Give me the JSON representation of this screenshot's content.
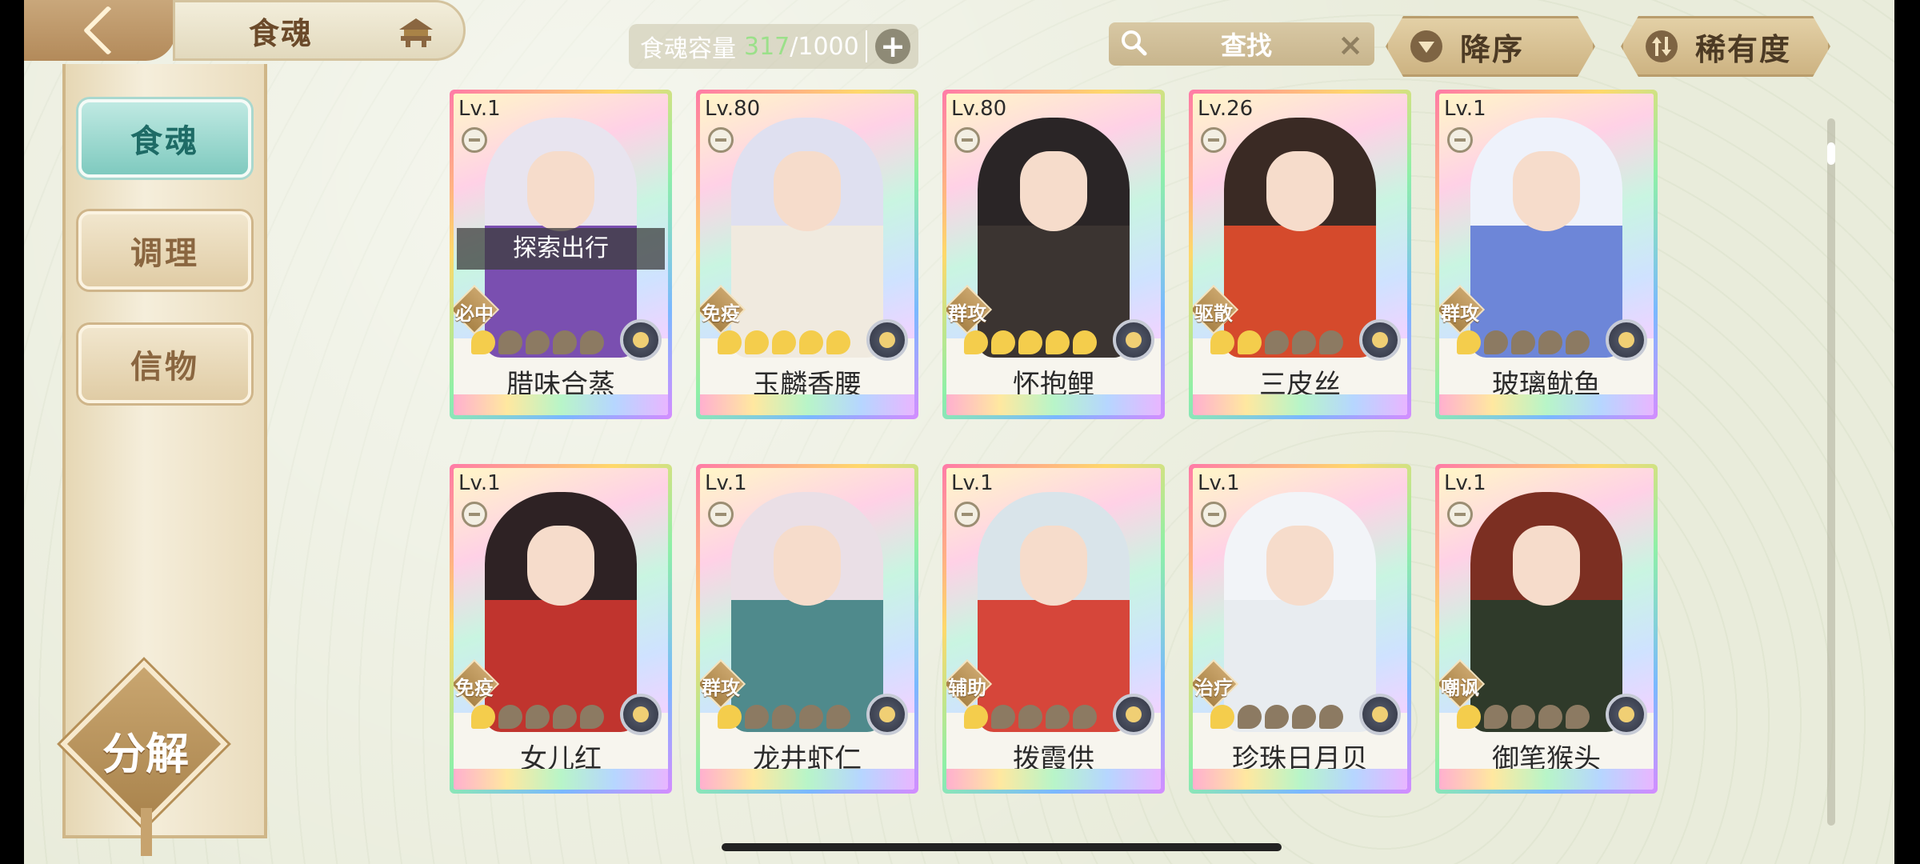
{
  "header": {
    "title": "食魂",
    "capacity": {
      "label": "食魂容量",
      "current": "317",
      "separator": "/",
      "max": "1000",
      "add": "+"
    },
    "search": {
      "text": "查找",
      "clear": "×"
    },
    "sort_order": "降序",
    "sort_field": "稀有度"
  },
  "sidebar": {
    "items": [
      {
        "label": "食魂",
        "active": true
      },
      {
        "label": "调理",
        "active": false
      },
      {
        "label": "信物",
        "active": false
      }
    ],
    "decompose": "分解"
  },
  "cards": [
    {
      "level": "Lv.1",
      "role": "必中",
      "stars": 1,
      "name": "腊味合蒸",
      "status": "探索出行",
      "hair": "#e8e4ef",
      "robe": "#7a4fb0"
    },
    {
      "level": "Lv.80",
      "role": "免疫",
      "stars": 5,
      "name": "玉麟香腰",
      "status": "",
      "hair": "#dfe0f0",
      "robe": "#f0eadf"
    },
    {
      "level": "Lv.80",
      "role": "群攻",
      "stars": 5,
      "name": "怀抱鲤",
      "status": "",
      "hair": "#2a2526",
      "robe": "#3b3431"
    },
    {
      "level": "Lv.26",
      "role": "驱散",
      "stars": 2,
      "name": "三皮丝",
      "status": "",
      "hair": "#3a2a24",
      "robe": "#d54a2c"
    },
    {
      "level": "Lv.1",
      "role": "群攻",
      "stars": 1,
      "name": "玻璃鱿鱼",
      "status": "",
      "hair": "#eef2fb",
      "robe": "#6d86d8"
    },
    {
      "level": "Lv.1",
      "role": "免疫",
      "stars": 1,
      "name": "女儿红",
      "status": "",
      "hair": "#2e2224",
      "robe": "#c0342e"
    },
    {
      "level": "Lv.1",
      "role": "群攻",
      "stars": 1,
      "name": "龙井虾仁",
      "status": "",
      "hair": "#eadfe6",
      "robe": "#4f8a8c"
    },
    {
      "level": "Lv.1",
      "role": "辅助",
      "stars": 1,
      "name": "拨霞供",
      "status": "",
      "hair": "#d9e4ea",
      "robe": "#d6463a"
    },
    {
      "level": "Lv.1",
      "role": "治疗",
      "stars": 1,
      "name": "珍珠日月贝",
      "status": "",
      "hair": "#f2f4f8",
      "robe": "#e8ecf0"
    },
    {
      "level": "Lv.1",
      "role": "嘲讽",
      "stars": 1,
      "name": "御笔猴头",
      "status": "",
      "hair": "#7c2f22",
      "robe": "#2f3a2a"
    }
  ],
  "colors": {
    "accent": "#7fcabf",
    "gold": "#c9a670",
    "capacity_current": "#9be08a"
  }
}
